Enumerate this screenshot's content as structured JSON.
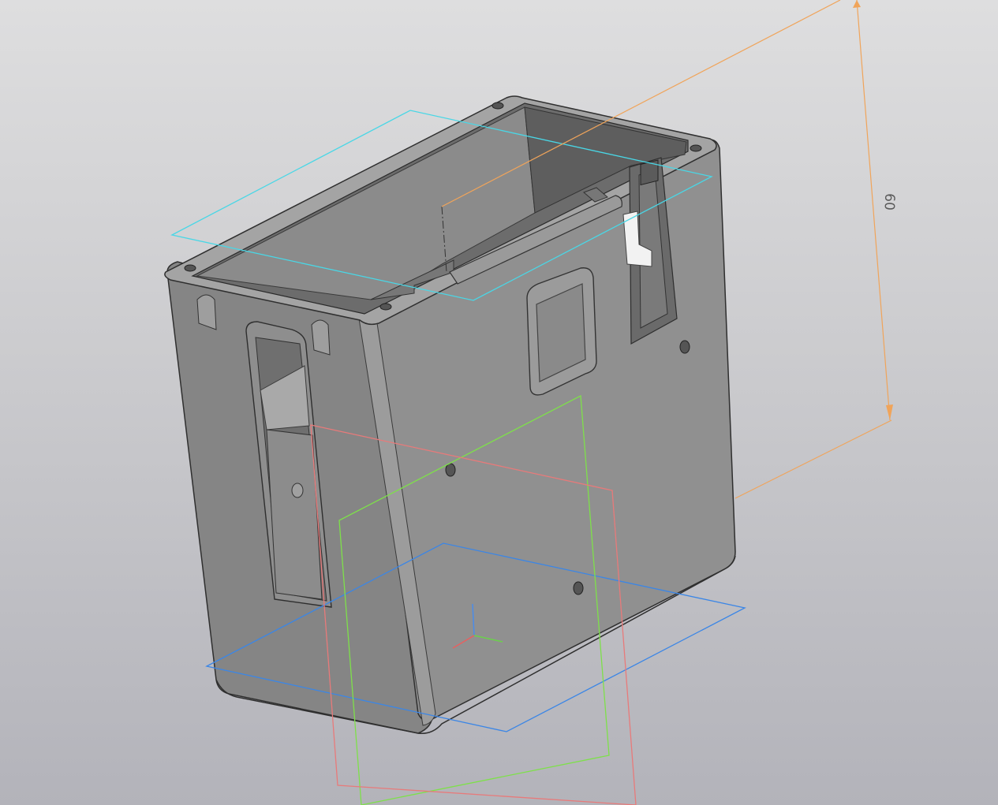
{
  "dimension": {
    "value": "60"
  },
  "colors": {
    "background_top": "#dededf",
    "background_bottom": "#b3b3ba",
    "body_front": "#8f8f8f",
    "body_side": "#838383",
    "body_inner": "#6f6f6f",
    "dimension_line": "#f0a45a",
    "plane_top": "#49d7e6",
    "plane_bottom": "#3b86e6",
    "plane_green": "#7ee04a",
    "plane_red": "#e87a7a",
    "axis_x": "#e86060",
    "axis_y": "#6ad24a",
    "axis_z": "#4a8cea"
  }
}
